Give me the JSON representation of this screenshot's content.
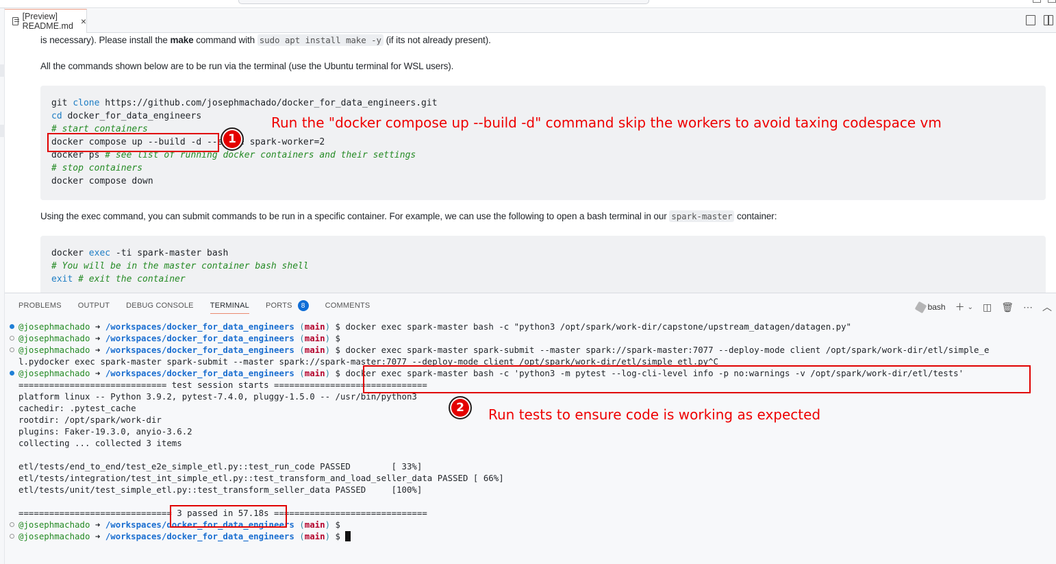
{
  "editor": {
    "tab_title": "[Preview] README.md",
    "tab_close": "×"
  },
  "preview": {
    "para1": {
      "pre": "is necessary). Please install the ",
      "bold": "make",
      "mid": " command with ",
      "code": "sudo apt install make -y",
      "post": " (if its not already present)."
    },
    "para2": "All the commands shown below are to be run via the terminal (use the Ubuntu terminal for WSL users).",
    "code1": [
      {
        "kw": "",
        "a": "git ",
        "k": "clone",
        "b": " https://github.com/josephmachado/docker_for_data_engineers.git",
        "c": ""
      },
      {
        "a": "",
        "k": "cd",
        "b": " docker_for_data_engineers",
        "c": ""
      },
      {
        "a": "",
        "k": "",
        "b": "",
        "c": "# start containers"
      },
      {
        "a": "docker compose up --build -d --scale spark-worker=2",
        "k": "",
        "b": "",
        "c": ""
      },
      {
        "a": "docker ps ",
        "k": "",
        "b": "",
        "c": "# see list of running docker containers and their settings"
      },
      {
        "a": "",
        "k": "",
        "b": "",
        "c": "# stop containers"
      },
      {
        "a": "docker compose down",
        "k": "",
        "b": "",
        "c": ""
      }
    ],
    "para3": {
      "pre": "Using the exec command, you can submit commands to be run in a specific container. For example, we can use the following to open a bash terminal in our ",
      "code": "spark-master",
      "post": " container:"
    },
    "code2": [
      {
        "a": "docker ",
        "k": "exec",
        "b": " -ti spark-master bash",
        "c": ""
      },
      {
        "a": "",
        "k": "",
        "b": "",
        "c": "# You will be in the master container bash shell"
      },
      {
        "a": "",
        "k": "exit",
        "b": " ",
        "c": "# exit the container"
      }
    ]
  },
  "annotations": {
    "one": {
      "number": "1",
      "text": "Run the \"docker compose up --build -d\" command skip the workers to avoid taxing codespace vm"
    },
    "two": {
      "number": "2",
      "text": "Run tests to ensure code is working as expected"
    }
  },
  "panel": {
    "tabs": [
      {
        "label": "PROBLEMS",
        "active": false
      },
      {
        "label": "OUTPUT",
        "active": false
      },
      {
        "label": "DEBUG CONSOLE",
        "active": false
      },
      {
        "label": "TERMINAL",
        "active": true
      },
      {
        "label": "PORTS",
        "active": false,
        "badge": "8"
      },
      {
        "label": "COMMENTS",
        "active": false
      }
    ],
    "shell_name": "bash",
    "icons": [
      "terminal-profile-icon",
      "new-terminal-plus-icon",
      "chevron-down-icon",
      "split-terminal-icon",
      "kill-terminal-trash-icon",
      "more-actions-icon",
      "maximize-panel-chevron-up-icon"
    ]
  },
  "terminal": {
    "prompt": {
      "user": "@josephmachado",
      "arrow": "➜",
      "path": "/workspaces/docker_for_data_engineers",
      "branch": "main",
      "dollar": "$"
    },
    "lines": [
      {
        "type": "prompt",
        "dot": "filled",
        "cmd": "docker exec spark-master bash -c \"python3 /opt/spark/work-dir/capstone/upstream_datagen/datagen.py\""
      },
      {
        "type": "prompt",
        "dot": "hollow",
        "cmd": ""
      },
      {
        "type": "prompt",
        "dot": "hollow",
        "cmd": "docker exec spark-master spark-submit --master spark://spark-master:7077 --deploy-mode client /opt/spark/work-dir/etl/simple_e"
      },
      {
        "type": "text",
        "text": "l.pydocker exec spark-master spark-submit --master spark://spark-master:7077 --deploy-mode client /opt/spark/work-dir/etl/simple_etl.py^C"
      },
      {
        "type": "prompt",
        "dot": "filled",
        "cmd": "docker exec spark-master bash -c 'python3 -m pytest --log-cli-level info -p no:warnings -v /opt/spark/work-dir/etl/tests'"
      },
      {
        "type": "text",
        "text": "============================= test session starts =============================="
      },
      {
        "type": "text",
        "text": "platform linux -- Python 3.9.2, pytest-7.4.0, pluggy-1.5.0 -- /usr/bin/python3"
      },
      {
        "type": "text",
        "text": "cachedir: .pytest_cache"
      },
      {
        "type": "text",
        "text": "rootdir: /opt/spark/work-dir"
      },
      {
        "type": "text",
        "text": "plugins: Faker-19.3.0, anyio-3.6.2"
      },
      {
        "type": "text",
        "text": "collecting ... collected 3 items"
      },
      {
        "type": "text",
        "text": ""
      },
      {
        "type": "text",
        "text": "etl/tests/end_to_end/test_e2e_simple_etl.py::test_run_code PASSED        [ 33%]"
      },
      {
        "type": "text",
        "text": "etl/tests/integration/test_int_simple_etl.py::test_transform_and_load_seller_data PASSED [ 66%]"
      },
      {
        "type": "text",
        "text": "etl/tests/unit/test_simple_etl.py::test_transform_seller_data PASSED     [100%]"
      },
      {
        "type": "text",
        "text": ""
      },
      {
        "type": "text",
        "text": "============================== 3 passed in 57.18s =============================="
      },
      {
        "type": "prompt",
        "dot": "hollow",
        "cmd": ""
      },
      {
        "type": "prompt",
        "dot": "hollow",
        "cmd": "",
        "cursor": true
      }
    ]
  }
}
